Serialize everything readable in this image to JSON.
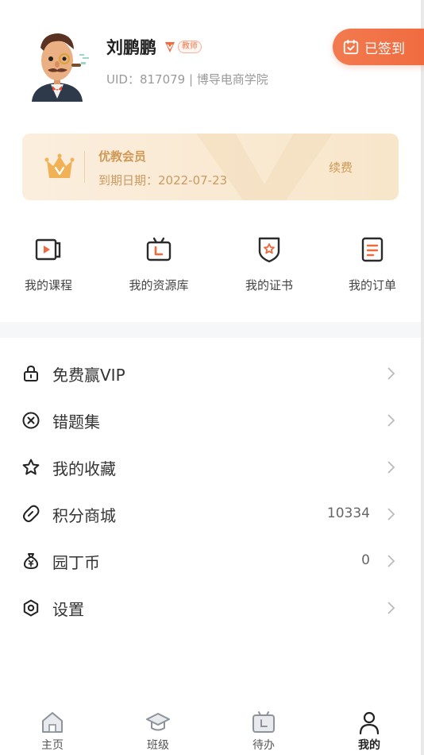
{
  "profile": {
    "name": "刘鹏鹏",
    "role_badge": "教师",
    "uid_line": "UID：817079 | 博导电商学院",
    "checkin_label": "已签到"
  },
  "vip": {
    "title": "优教会员",
    "expire": "到期日期：2022-07-23",
    "renew_label": "续费"
  },
  "shortcuts": [
    {
      "label": "我的课程",
      "icon": "course-icon"
    },
    {
      "label": "我的资源库",
      "icon": "resource-library-icon"
    },
    {
      "label": "我的证书",
      "icon": "certificate-icon"
    },
    {
      "label": "我的订单",
      "icon": "order-icon"
    }
  ],
  "menu": [
    {
      "label": "免费赢VIP",
      "value": "",
      "icon": "lock-icon"
    },
    {
      "label": "错题集",
      "value": "",
      "icon": "wrong-circle-icon"
    },
    {
      "label": "我的收藏",
      "value": "",
      "icon": "star-icon"
    },
    {
      "label": "积分商城",
      "value": "10334",
      "icon": "points-tag-icon"
    },
    {
      "label": "园丁币",
      "value": "0",
      "icon": "money-bag-icon"
    },
    {
      "label": "设置",
      "value": "",
      "icon": "settings-icon"
    }
  ],
  "tabs": [
    {
      "label": "主页",
      "icon": "home-icon"
    },
    {
      "label": "班级",
      "icon": "class-icon"
    },
    {
      "label": "待办",
      "icon": "todo-icon"
    },
    {
      "label": "我的",
      "icon": "profile-icon",
      "active": true
    }
  ],
  "colors": {
    "accent": "#ef6a3e",
    "vip_gold": "#cf9a58",
    "icon_dark": "#2b2b2b"
  }
}
